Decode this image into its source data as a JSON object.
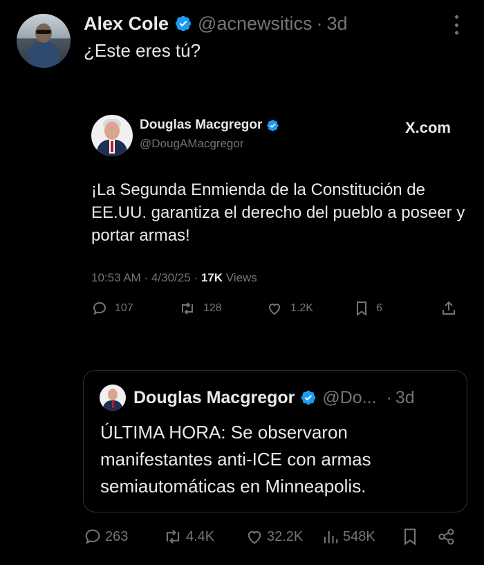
{
  "post": {
    "author_name": "Alex Cole",
    "handle": "@acnewsitics",
    "separator": "·",
    "age": "3d",
    "text": "¿Este eres tú?"
  },
  "embedded": {
    "author_name": "Douglas Macgregor",
    "handle": "@DougAMacgregor",
    "source": "X.com",
    "text": "¡La Segunda Enmienda de la Constitución de EE.UU. garantiza el derecho del pueblo a poseer y portar armas!",
    "time": "10:53 AM",
    "date": "4/30/25",
    "sep": "·",
    "views_count": "17K",
    "views_label": "Views",
    "actions": {
      "replies": "107",
      "reposts": "128",
      "likes": "1.2K",
      "bookmarks": "6"
    }
  },
  "quote": {
    "author_name": "Douglas Macgregor",
    "handle": "@Do...",
    "separator": "·",
    "age": "3d",
    "text": "ÚLTIMA HORA: Se observaron manifestantes anti-ICE con armas semiautomáticas en Minneapolis."
  },
  "actions": {
    "replies": "263",
    "reposts": "4.4K",
    "likes": "32.2K",
    "views": "548K"
  },
  "colors": {
    "background": "#000000",
    "text": "#e7e9ea",
    "muted": "#71767b",
    "verified": "#1d9bf0",
    "border": "#2f3336"
  }
}
